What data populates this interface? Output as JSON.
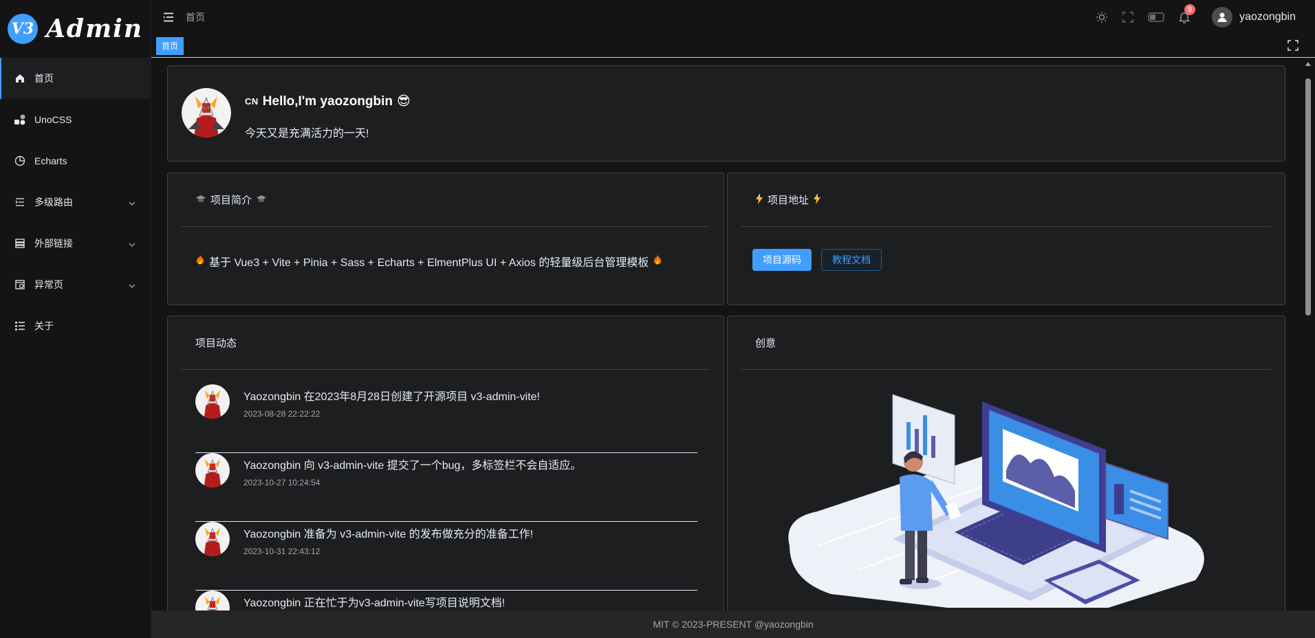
{
  "app": {
    "logo_badge": "V3",
    "logo_text": "Admin"
  },
  "sidebar": {
    "items": [
      {
        "label": "首页",
        "icon": "home-icon",
        "active": true
      },
      {
        "label": "UnoCSS",
        "icon": "shapes-icon"
      },
      {
        "label": "Echarts",
        "icon": "pie-chart-icon"
      },
      {
        "label": "多级路由",
        "icon": "menu-list-icon",
        "expandable": true
      },
      {
        "label": "外部链接",
        "icon": "server-icon",
        "expandable": true
      },
      {
        "label": "异常页",
        "icon": "error-page-icon",
        "expandable": true
      },
      {
        "label": "关于",
        "icon": "list-icon"
      }
    ]
  },
  "header": {
    "breadcrumb": "首页",
    "notification_count": "9",
    "username": "yaozongbin"
  },
  "tags": {
    "active": "首页"
  },
  "hello": {
    "cn_tag": "CN",
    "title": "Hello,I'm yaozongbin",
    "emoji": "😎",
    "subtitle": "今天又是充满活力的一天!"
  },
  "intro": {
    "title": "项目简介",
    "body": "基于 Vue3 + Vite + Pinia + Sass + Echarts + ElmentPlus UI + Axios 的轻量级后台管理模板"
  },
  "address": {
    "title": "项目地址",
    "source_button": "项目源码",
    "docs_button": "教程文档"
  },
  "news": {
    "title": "项目动态",
    "items": [
      {
        "text": "Yaozongbin 在2023年8月28日创建了开源项目 v3-admin-vite!",
        "date": "2023-08-28 22:22:22"
      },
      {
        "text": "Yaozongbin 向 v3-admin-vite 提交了一个bug，多标签栏不会自适应。",
        "date": "2023-10-27 10:24:54"
      },
      {
        "text": "Yaozongbin 准备为 v3-admin-vite 的发布做充分的准备工作!",
        "date": "2023-10-31 22:43:12"
      },
      {
        "text": "Yaozongbin 正在忙于为v3-admin-vite写项目说明文档!",
        "date": ""
      }
    ]
  },
  "idea": {
    "title": "创意"
  },
  "footer": {
    "text": "MIT © 2023-PRESENT @yaozongbin"
  },
  "colors": {
    "accent": "#409eff",
    "badge": "#f56c6c",
    "bg": "#141414",
    "card": "#1d1e1f"
  }
}
